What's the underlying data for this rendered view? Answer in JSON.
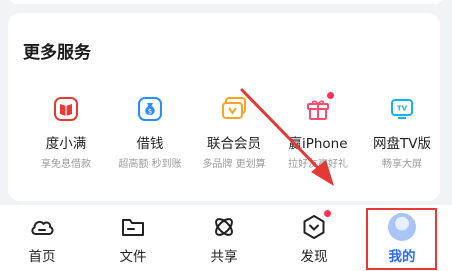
{
  "section": {
    "title": "更多服务"
  },
  "services": [
    {
      "label": "度小满",
      "sub": "享免息借款",
      "icon": "duxiaoman-icon"
    },
    {
      "label": "借钱",
      "sub": "超高额 秒到账",
      "icon": "money-bag-icon"
    },
    {
      "label": "联合会员",
      "sub": "多品牌 更划算",
      "icon": "vip-card-icon"
    },
    {
      "label": "赢iPhone",
      "sub": "拉好友赢好礼",
      "icon": "gift-icon"
    },
    {
      "label": "网盘TV版",
      "sub": "畅享大屏",
      "icon": "tv-icon"
    }
  ],
  "nav": [
    {
      "label": "首页",
      "icon": "cloud-icon"
    },
    {
      "label": "文件",
      "icon": "folder-icon"
    },
    {
      "label": "共享",
      "icon": "share-icon"
    },
    {
      "label": "发现",
      "icon": "discover-icon"
    },
    {
      "label": "我的",
      "icon": "avatar"
    }
  ],
  "colors": {
    "accent": "#2b6bff",
    "badge": "#ff3355",
    "annotation": "#e53935"
  }
}
